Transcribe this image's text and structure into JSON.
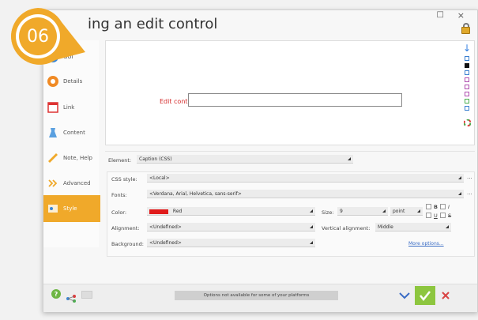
{
  "window": {
    "title": "ing an edit control",
    "ctrl_restore": "□",
    "ctrl_close": "×"
  },
  "badge": {
    "number": "06",
    "color": "#f0a92a"
  },
  "sidebar": {
    "items": [
      {
        "label": "GUI",
        "icon": "gui-icon"
      },
      {
        "label": "Details",
        "icon": "details-icon"
      },
      {
        "label": "Link",
        "icon": "link-icon"
      },
      {
        "label": "Content",
        "icon": "content-icon"
      },
      {
        "label": "Note, Help",
        "icon": "note-icon"
      },
      {
        "label": "Advanced",
        "icon": "advanced-icon"
      },
      {
        "label": "Style",
        "icon": "style-icon",
        "active": true
      }
    ]
  },
  "preview": {
    "edit_control_label": "Edit control"
  },
  "properties": {
    "element_label": "Element:",
    "element_value": "Caption (CSS)",
    "css_style_label": "CSS style:",
    "css_style_value": "<Local>",
    "fonts_label": "Fonts:",
    "fonts_value": "<Verdana, Arial, Helvetica, sans-serif>",
    "color_label": "Color:",
    "color_value": "Red",
    "color_swatch": "#e01b1b",
    "size_label": "Size:",
    "size_value": "9",
    "size_unit": "point",
    "bold_label": "B",
    "italic_label": "I",
    "underline_label": "U",
    "strike_label": "S",
    "alignment_label": "Alignment:",
    "alignment_value": "<Undefined>",
    "valign_label": "Vertical alignment:",
    "valign_value": "Middle",
    "background_label": "Background:",
    "background_value": "<Undefined>",
    "more_options": "More options...",
    "ellipsis": "..."
  },
  "footer": {
    "help_label": "?",
    "status_text": "Options not available for some of your platforms",
    "ok_color": "#8dc63f",
    "cancel_color": "#d94343"
  },
  "colors": {
    "accent": "#f0a92a",
    "link": "#3a6cc5",
    "label_red": "#d42a2a"
  }
}
